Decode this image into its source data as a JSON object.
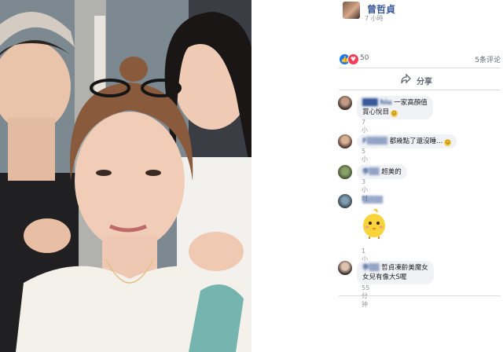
{
  "post": {
    "author": "曾哲貞",
    "time": "7 小時",
    "reaction_count": "50",
    "comment_count": "5条评论",
    "share_label": "分享"
  },
  "comments": [
    {
      "name": "███ hiu",
      "text": "一家高顏值",
      "text2": "賞心悅目",
      "emoji": true,
      "time": "7小时"
    },
    {
      "name": "F▒▒▒▒",
      "text": "都幾點了還沒睡...",
      "emoji": true,
      "time": "5小时"
    },
    {
      "name": "李▒▒",
      "text": "超美的",
      "emoji": false,
      "time": "3小时"
    },
    {
      "name": "▒▒▒▒",
      "text": "",
      "emoji": false,
      "sticker": "chick-sticker",
      "time": "1小时"
    },
    {
      "name": "李▒▒",
      "text": "哲貞凍齡美魔女",
      "text2": "女兒有像大S喔",
      "emoji": false,
      "time": "55分钟"
    }
  ],
  "icons": {
    "like": "like-icon",
    "love": "love-icon",
    "share": "share-icon"
  },
  "colors": {
    "link": "#385898",
    "like": "#1877f2",
    "love": "#f33e58",
    "bubble": "#f0f2f5"
  }
}
